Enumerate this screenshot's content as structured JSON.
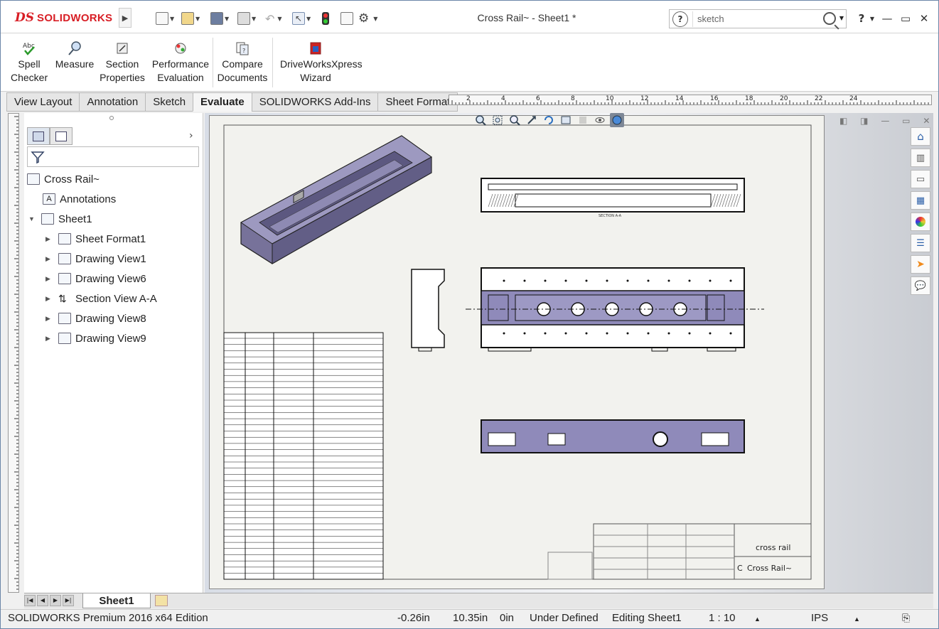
{
  "app": {
    "logo_ds": "DS",
    "logo_text": "SOLIDWORKS"
  },
  "title": "Cross Rail~ - Sheet1 *",
  "search": {
    "value": "sketch",
    "help": "?"
  },
  "window": {
    "help": "?",
    "minimize": "—",
    "restore": "▭",
    "close": "✕"
  },
  "ribbon": [
    {
      "label": "Spell Checker",
      "icon": "spell-check-icon"
    },
    {
      "label": "Measure",
      "icon": "measure-icon"
    },
    {
      "label": "Section Properties",
      "icon": "section-properties-icon"
    },
    {
      "label": "Performance Evaluation",
      "icon": "performance-icon"
    },
    {
      "label": "Compare Documents",
      "icon": "compare-icon"
    },
    {
      "label": "DriveWorksXpress Wizard",
      "icon": "driveworks-icon"
    }
  ],
  "tabs": [
    "View Layout",
    "Annotation",
    "Sketch",
    "Evaluate",
    "SOLIDWORKS Add-Ins",
    "Sheet Format"
  ],
  "active_tab": "Evaluate",
  "ruler": [
    "2",
    "4",
    "6",
    "8",
    "10",
    "12",
    "14",
    "16",
    "18",
    "20",
    "22",
    "24"
  ],
  "tree": {
    "root": "Cross Rail~",
    "items": [
      {
        "label": "Annotations",
        "indent": 1
      },
      {
        "label": "Sheet1",
        "indent": 1,
        "expanded": true
      },
      {
        "label": "Sheet Format1",
        "indent": 2
      },
      {
        "label": "Drawing View1",
        "indent": 2
      },
      {
        "label": "Drawing View6",
        "indent": 2
      },
      {
        "label": "Section View A-A",
        "indent": 2
      },
      {
        "label": "Drawing View8",
        "indent": 2
      },
      {
        "label": "Drawing View9",
        "indent": 2
      }
    ]
  },
  "drawing": {
    "title_block_name": "cross rail",
    "title_block_size": "C",
    "title_block_part": "Cross Rail~",
    "section_label": "SECTION A-A"
  },
  "sheet_tab": "Sheet1",
  "status": {
    "edition": "SOLIDWORKS Premium 2016 x64 Edition",
    "x": "-0.26in",
    "y": "10.35in",
    "z": "0in",
    "state": "Under Defined",
    "editing": "Editing Sheet1",
    "scale": "1 : 10",
    "units": "IPS"
  },
  "colors": {
    "brand": "#d81e25",
    "part": "#8f8aba",
    "sheet": "#f2f2ee"
  }
}
